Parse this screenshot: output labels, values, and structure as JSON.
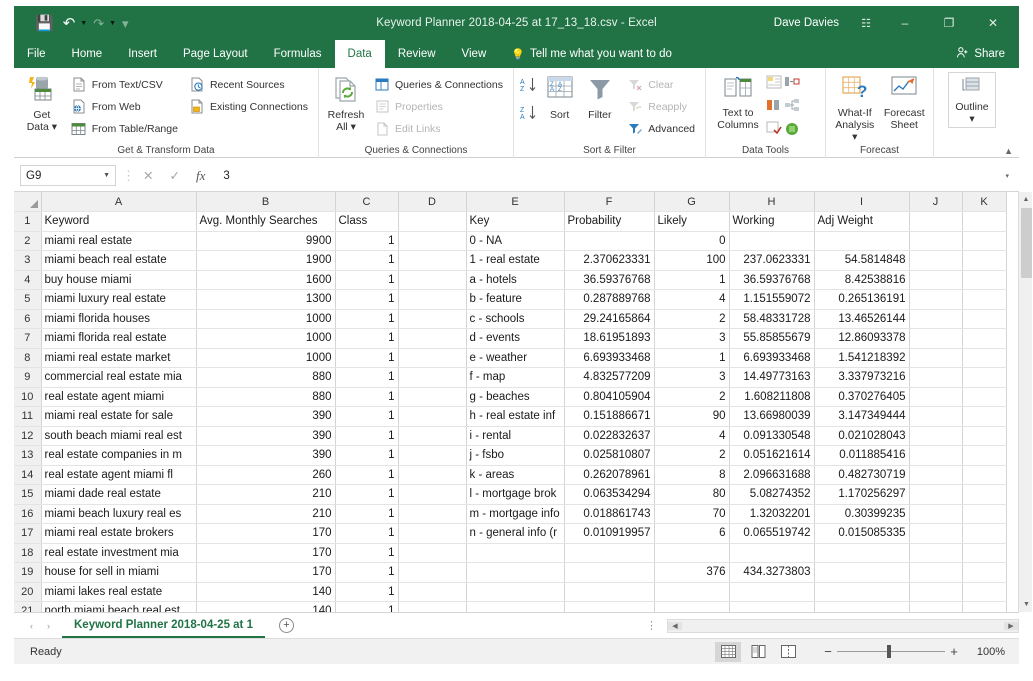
{
  "window": {
    "title": "Keyword Planner 2018-04-25 at 17_13_18.csv  -  Excel",
    "user": "Dave Davies",
    "quick_access": [
      "save-icon",
      "undo-icon",
      "redo-icon",
      "customize-icon"
    ],
    "ribbon_display_options": "ribbon-display-icon",
    "minimize": "–",
    "restore": "❐",
    "close": "✕"
  },
  "ribbon": {
    "tabs": [
      {
        "label": "File",
        "active": false
      },
      {
        "label": "Home",
        "active": false
      },
      {
        "label": "Insert",
        "active": false
      },
      {
        "label": "Page Layout",
        "active": false
      },
      {
        "label": "Formulas",
        "active": false
      },
      {
        "label": "Data",
        "active": true
      },
      {
        "label": "Review",
        "active": false
      },
      {
        "label": "View",
        "active": false
      }
    ],
    "tell_me": "Tell me what you want to do",
    "share": "Share",
    "groups": [
      {
        "name": "Get & Transform Data",
        "big": {
          "label_line1": "Get",
          "label_line2": "Data ▾"
        },
        "items": [
          {
            "label": "From Text/CSV",
            "disabled": false
          },
          {
            "label": "From Web",
            "disabled": false
          },
          {
            "label": "From Table/Range",
            "disabled": false
          },
          {
            "label": "Recent Sources",
            "disabled": false
          },
          {
            "label": "Existing Connections",
            "disabled": false
          }
        ]
      },
      {
        "name": "Queries & Connections",
        "big": {
          "label_line1": "Refresh",
          "label_line2": "All ▾"
        },
        "items": [
          {
            "label": "Queries & Connections",
            "disabled": false
          },
          {
            "label": "Properties",
            "disabled": true
          },
          {
            "label": "Edit Links",
            "disabled": true
          }
        ]
      },
      {
        "name": "Sort & Filter",
        "sort_label": "Sort",
        "filter_label": "Filter",
        "items": [
          {
            "label": "Clear",
            "disabled": true
          },
          {
            "label": "Reapply",
            "disabled": true
          },
          {
            "label": "Advanced",
            "disabled": false
          }
        ]
      },
      {
        "name": "Data Tools",
        "big": {
          "label_line1": "Text to",
          "label_line2": "Columns"
        }
      },
      {
        "name": "Forecast",
        "what_if_line1": "What-If",
        "what_if_line2": "Analysis ▾",
        "forecast_line1": "Forecast",
        "forecast_line2": "Sheet"
      },
      {
        "name": "Outline",
        "outline_line1": "Outline",
        "outline_line2": "▾"
      }
    ],
    "collapse": "▲"
  },
  "formula_bar": {
    "name_box": "G9",
    "cancel": "✕",
    "enter": "✓",
    "fx": "fx",
    "value": "3",
    "expand": "▾"
  },
  "grid": {
    "columns": [
      "A",
      "B",
      "C",
      "D",
      "E",
      "F",
      "G",
      "H",
      "I",
      "J",
      "K"
    ],
    "header_row_number": "1",
    "headers": [
      "Keyword",
      "Avg. Monthly Searches",
      "Class",
      "",
      "Key",
      "Probability",
      "Likely",
      "Working",
      "Adj Weight",
      "",
      ""
    ],
    "rows": [
      {
        "n": "2",
        "a": "miami real estate",
        "b": "9900",
        "c": "1",
        "d": "",
        "e": "0 - NA",
        "f": "",
        "g": "0",
        "h": "",
        "i": ""
      },
      {
        "n": "3",
        "a": "miami beach real estate",
        "b": "1900",
        "c": "1",
        "d": "",
        "e": "1 - real estate",
        "f": "2.370623331",
        "g": "100",
        "h": "237.0623331",
        "i": "54.5814848"
      },
      {
        "n": "4",
        "a": "buy house miami",
        "b": "1600",
        "c": "1",
        "d": "",
        "e": "a - hotels",
        "f": "36.59376768",
        "g": "1",
        "h": "36.59376768",
        "i": "8.42538816"
      },
      {
        "n": "5",
        "a": "miami luxury real estate",
        "b": "1300",
        "c": "1",
        "d": "",
        "e": "b - feature",
        "f": "0.287889768",
        "g": "4",
        "h": "1.151559072",
        "i": "0.265136191"
      },
      {
        "n": "6",
        "a": "miami florida houses",
        "b": "1000",
        "c": "1",
        "d": "",
        "e": "c - schools",
        "f": "29.24165864",
        "g": "2",
        "h": "58.48331728",
        "i": "13.46526144"
      },
      {
        "n": "7",
        "a": "miami florida real estate",
        "b": "1000",
        "c": "1",
        "d": "",
        "e": "d - events",
        "f": "18.61951893",
        "g": "3",
        "h": "55.85855679",
        "i": "12.86093378"
      },
      {
        "n": "8",
        "a": "miami real estate market",
        "b": "1000",
        "c": "1",
        "d": "",
        "e": "e - weather",
        "f": "6.693933468",
        "g": "1",
        "h": "6.693933468",
        "i": "1.541218392"
      },
      {
        "n": "9",
        "a": "commercial real estate mia",
        "b": "880",
        "c": "1",
        "d": "",
        "e": "f - map",
        "f": "4.832577209",
        "g": "3",
        "h": "14.49773163",
        "i": "3.337973216"
      },
      {
        "n": "10",
        "a": "real estate agent miami",
        "b": "880",
        "c": "1",
        "d": "",
        "e": "g - beaches",
        "f": "0.804105904",
        "g": "2",
        "h": "1.608211808",
        "i": "0.370276405"
      },
      {
        "n": "11",
        "a": "miami real estate for sale",
        "b": "390",
        "c": "1",
        "d": "",
        "e": "h - real estate inf",
        "f": "0.151886671",
        "g": "90",
        "h": "13.66980039",
        "i": "3.147349444"
      },
      {
        "n": "12",
        "a": "south beach miami real est",
        "b": "390",
        "c": "1",
        "d": "",
        "e": "i - rental",
        "f": "0.022832637",
        "g": "4",
        "h": "0.091330548",
        "i": "0.021028043"
      },
      {
        "n": "13",
        "a": "real estate companies in m",
        "b": "390",
        "c": "1",
        "d": "",
        "e": "j - fsbo",
        "f": "0.025810807",
        "g": "2",
        "h": "0.051621614",
        "i": "0.011885416"
      },
      {
        "n": "14",
        "a": "real estate agent miami fl",
        "b": "260",
        "c": "1",
        "d": "",
        "e": "k - areas",
        "f": "0.262078961",
        "g": "8",
        "h": "2.096631688",
        "i": "0.482730719"
      },
      {
        "n": "15",
        "a": "miami dade real estate",
        "b": "210",
        "c": "1",
        "d": "",
        "e": "l - mortgage brok",
        "f": "0.063534294",
        "g": "80",
        "h": "5.08274352",
        "i": "1.170256297"
      },
      {
        "n": "16",
        "a": "miami beach luxury real es",
        "b": "210",
        "c": "1",
        "d": "",
        "e": "m - mortgage info",
        "f": "0.018861743",
        "g": "70",
        "h": "1.32032201",
        "i": "0.30399235"
      },
      {
        "n": "17",
        "a": "miami real estate brokers",
        "b": "170",
        "c": "1",
        "d": "",
        "e": "n - general info (r",
        "f": "0.010919957",
        "g": "6",
        "h": "0.065519742",
        "i": "0.015085335"
      },
      {
        "n": "18",
        "a": "real estate investment mia",
        "b": "170",
        "c": "1",
        "d": "",
        "e": "",
        "f": "",
        "g": "",
        "h": "",
        "i": ""
      },
      {
        "n": "19",
        "a": "house for sell in miami",
        "b": "170",
        "c": "1",
        "d": "",
        "e": "",
        "f": "",
        "g": "376",
        "h": "434.3273803",
        "i": ""
      },
      {
        "n": "20",
        "a": "miami lakes real estate",
        "b": "140",
        "c": "1",
        "d": "",
        "e": "",
        "f": "",
        "g": "",
        "h": "",
        "i": ""
      },
      {
        "n": "21",
        "a": "north miami beach real est",
        "b": "140",
        "c": "1",
        "d": "",
        "e": "",
        "f": "",
        "g": "",
        "h": "",
        "i": ""
      }
    ]
  },
  "sheet_tabs": {
    "prev": "‹",
    "next": "›",
    "tabs": [
      {
        "label": "Keyword Planner 2018-04-25 at 1",
        "active": true
      }
    ],
    "add": "+"
  },
  "status_bar": {
    "state": "Ready",
    "views": [
      "normal-view-icon",
      "page-layout-view-icon",
      "page-break-view-icon"
    ],
    "zoom_out": "−",
    "zoom_in": "+",
    "zoom_level": "100%"
  },
  "colors": {
    "excel_green": "#217346",
    "header_gray": "#f0f0f0",
    "grid_line": "#d4d4d4"
  }
}
